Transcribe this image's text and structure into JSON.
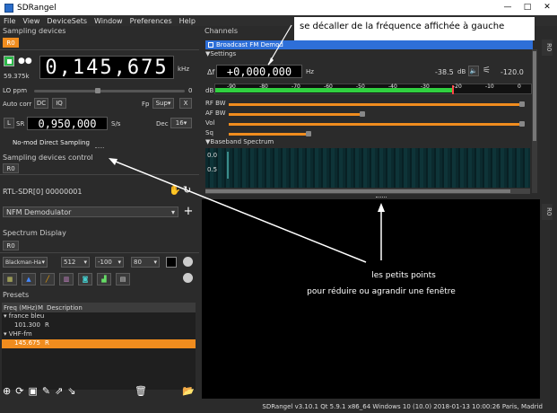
{
  "window": {
    "title": "SDRangel",
    "minimize": "—",
    "maximize": "□",
    "close": "✕"
  },
  "menu": [
    "File",
    "View",
    "DeviceSets",
    "Window",
    "Preferences",
    "Help"
  ],
  "sampling": {
    "title": "Sampling devices",
    "tab": "R0",
    "frequency": "0,145,675",
    "freq_unit": "kHz",
    "rate": "59.375k",
    "lo_label": "LO ppm",
    "lo_value": "0",
    "autocorr_label": "Auto corr",
    "dc": "DC",
    "iq": "IQ",
    "fp_label": "Fp",
    "fp_value": "Sup",
    "x_btn": "X",
    "l_btn": "L",
    "sr_label": "SR",
    "sr_value": "0,950,000",
    "sr_unit": "S/s",
    "dec_label": "Dec",
    "dec_value": "16",
    "status": "No-mod Direct Sampling"
  },
  "control": {
    "title": "Sampling devices control",
    "tab": "R0",
    "device": "RTL-SDR[0] 00000001",
    "demod": "NFM Demodulator",
    "add": "+"
  },
  "spectrum_display": {
    "title": "Spectrum Display",
    "tab": "R0",
    "window": "Blackman-Harris",
    "fft": "512",
    "ref": "-100",
    "range": "80"
  },
  "presets": {
    "title": "Presets",
    "col1": "Freq (MHz)",
    "col2": "M",
    "col3": "Description",
    "groups": [
      {
        "name": "france bleu",
        "items": [
          {
            "freq": "101.300",
            "mode": "R"
          }
        ]
      },
      {
        "name": "VHF-fm",
        "items": [
          {
            "freq": "145.675",
            "mode": "R"
          }
        ]
      }
    ]
  },
  "channels": {
    "title": "Channels",
    "channel_name": "Broadcast FM Demod",
    "settings": "Settings",
    "delta_label": "Δf",
    "delta_value": "+0,000,000",
    "delta_unit": "Hz",
    "power": "-38.5",
    "power_unit": "dB",
    "squelch": "-120.0",
    "db_label": "dB",
    "scale": [
      "-90",
      "-80",
      "-70",
      "-60",
      "-50",
      "-40",
      "-30",
      "-20",
      "-10",
      "0"
    ],
    "rfbw": "RF BW",
    "afbw": "AF BW",
    "vol": "Vol",
    "sq": "Sq",
    "baseband": "Baseband Spectrum",
    "y0": "0.0",
    "y1": "0.5",
    "side_tab": "R0",
    "side_tab2": "R0"
  },
  "statusbar": "SDRangel v3.10.1 Qt 5.9.1 x86_64 Windows 10 (10.0)  2018-01-13 10:00:26 Paris, Madrid",
  "annotations": {
    "top": "se décaller de la fréquence affichée à gauche",
    "line1": "les petits points",
    "line2": "pour réduire ou agrandir une fenêtre"
  },
  "colors": {
    "accent": "#f08c1e",
    "channel_bar": "#2e6fd8",
    "signal": "#30d040"
  }
}
